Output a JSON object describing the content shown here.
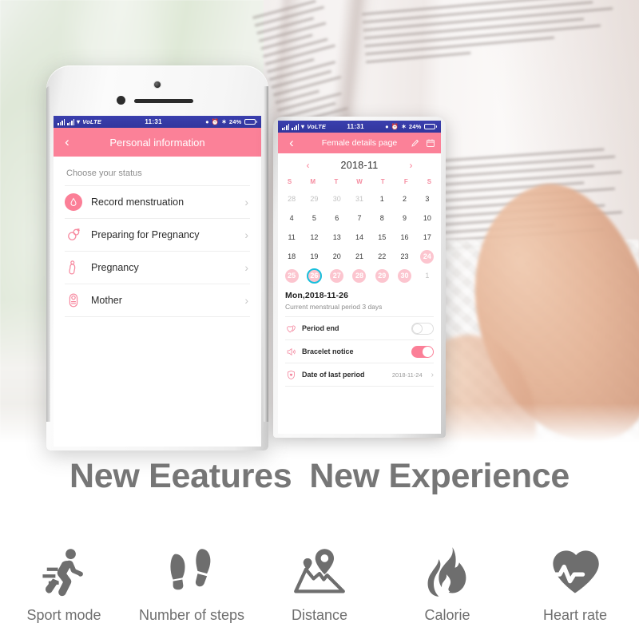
{
  "phone_left": {
    "status_bar": {
      "carrier": "VoLTE",
      "time": "11:31",
      "battery": "24%",
      "icons": [
        "signal-bars",
        "wifi",
        "volte",
        "do-not-disturb",
        "alarm",
        "bluetooth",
        "battery"
      ]
    },
    "header": {
      "title": "Personal information",
      "back_icon": "chevron-left-icon"
    },
    "section_label": "Choose your status",
    "items": [
      {
        "label": "Record menstruation",
        "icon": "menstruation-icon",
        "selected": true
      },
      {
        "label": "Preparing for Pregnancy",
        "icon": "preparing-pregnancy-icon",
        "selected": false
      },
      {
        "label": "Pregnancy",
        "icon": "pregnancy-icon",
        "selected": false
      },
      {
        "label": "Mother",
        "icon": "mother-baby-icon",
        "selected": false
      }
    ],
    "chevron": "›"
  },
  "phone_right": {
    "status_bar": {
      "carrier": "VoLTE",
      "time": "11:31",
      "battery": "24%"
    },
    "header": {
      "title": "Female details page",
      "back_icon": "chevron-left-icon",
      "actions": [
        "pen-edit-icon",
        "calendar-icon"
      ]
    },
    "calendar": {
      "month": "2018-11",
      "prev_icon": "chevron-left-icon",
      "next_icon": "chevron-right-icon",
      "dow": [
        "S",
        "M",
        "T",
        "W",
        "T",
        "F",
        "S"
      ],
      "weeks": [
        [
          {
            "n": "28",
            "muted": true
          },
          {
            "n": "29",
            "muted": true
          },
          {
            "n": "30",
            "muted": true
          },
          {
            "n": "31",
            "muted": true
          },
          {
            "n": "1"
          },
          {
            "n": "2"
          },
          {
            "n": "3"
          }
        ],
        [
          {
            "n": "4"
          },
          {
            "n": "5"
          },
          {
            "n": "6"
          },
          {
            "n": "7"
          },
          {
            "n": "8"
          },
          {
            "n": "9"
          },
          {
            "n": "10"
          }
        ],
        [
          {
            "n": "11"
          },
          {
            "n": "12"
          },
          {
            "n": "13"
          },
          {
            "n": "14"
          },
          {
            "n": "15"
          },
          {
            "n": "16"
          },
          {
            "n": "17"
          }
        ],
        [
          {
            "n": "18"
          },
          {
            "n": "19"
          },
          {
            "n": "20"
          },
          {
            "n": "21"
          },
          {
            "n": "22"
          },
          {
            "n": "23"
          },
          {
            "n": "24",
            "period": true
          }
        ],
        [
          {
            "n": "25",
            "period": true
          },
          {
            "n": "26",
            "period": true,
            "today": true
          },
          {
            "n": "27",
            "period": true
          },
          {
            "n": "28",
            "period": true
          },
          {
            "n": "29",
            "period": true
          },
          {
            "n": "30",
            "period": true
          },
          {
            "n": "1",
            "muted": true
          }
        ]
      ]
    },
    "day_info": {
      "date": "Mon,2018-11-26",
      "note": "Current menstrual period 3 days"
    },
    "options": [
      {
        "label": "Period end",
        "icon": "double-heart-icon",
        "control": "toggle",
        "value": "off"
      },
      {
        "label": "Bracelet notice",
        "icon": "speaker-notice-icon",
        "control": "toggle",
        "value": "on"
      },
      {
        "label": "Date of last period",
        "icon": "heart-shield-icon",
        "control": "value",
        "value": "2018-11-24",
        "chevron": "›"
      }
    ]
  },
  "headline": {
    "part1": "New Eeatures",
    "part2": "New Experience"
  },
  "features": [
    {
      "label": "Sport mode",
      "icon": "running-person-icon"
    },
    {
      "label": "Number of steps",
      "icon": "footprints-icon"
    },
    {
      "label": "Distance",
      "icon": "map-pin-icon"
    },
    {
      "label": "Calorie",
      "icon": "flame-icon"
    },
    {
      "label": "Heart rate",
      "icon": "heart-pulse-icon"
    }
  ],
  "colors": {
    "accent_pink": "#FB8198",
    "period_pink": "#FCC5CF",
    "today_ring": "#17BFDC",
    "status_bar": "#3A3FAE",
    "text_gray": "#767676"
  }
}
